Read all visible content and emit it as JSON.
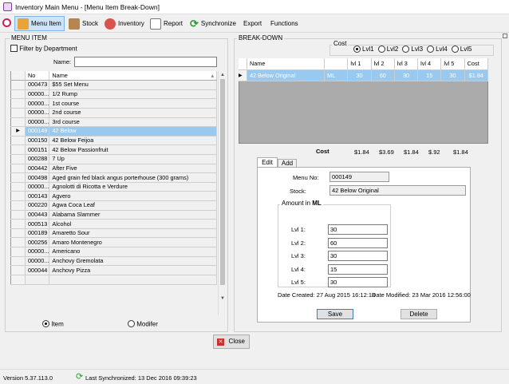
{
  "window": {
    "title": "Inventory Main Menu - [Menu Item Break-Down]"
  },
  "toolbar": [
    {
      "label": "Menu Item",
      "icon": "menu-item-icon",
      "active": true
    },
    {
      "label": "Stock",
      "icon": "stock-icon",
      "active": false
    },
    {
      "label": "Inventory",
      "icon": "inventory-icon",
      "active": false
    },
    {
      "label": "Report",
      "icon": "report-icon",
      "active": false
    },
    {
      "label": "Synchronize",
      "icon": "sync-icon",
      "active": false
    },
    {
      "label": "Export",
      "active": false
    },
    {
      "label": "Functions",
      "active": false
    }
  ],
  "menu_item": {
    "group_title": "MENU ITEM",
    "filter_label": "Filter by Department",
    "filter_checked": false,
    "name_label": "Name:",
    "name_value": "",
    "columns": [
      "No",
      "Name"
    ],
    "rows": [
      {
        "no": "000473",
        "name": "$55 Set Menu"
      },
      {
        "no": "00000...",
        "name": "1/2 Rump"
      },
      {
        "no": "00000...",
        "name": "1st course"
      },
      {
        "no": "00000...",
        "name": "2nd course"
      },
      {
        "no": "00000...",
        "name": "3rd course"
      },
      {
        "no": "000149",
        "name": "42 Below",
        "selected": true
      },
      {
        "no": "000150",
        "name": "42 Below Feijoa"
      },
      {
        "no": "000151",
        "name": "42 Below Passionfruit"
      },
      {
        "no": "000288",
        "name": "7 Up"
      },
      {
        "no": "000442",
        "name": "After Five"
      },
      {
        "no": "000498",
        "name": "Aged grain fed black angus porterhouse (300 grams)"
      },
      {
        "no": "00000...",
        "name": "Agnolotti di Ricotta e Verdure"
      },
      {
        "no": "000143",
        "name": "Agvero"
      },
      {
        "no": "000220",
        "name": "Agwa Coca Leaf"
      },
      {
        "no": "000443",
        "name": "Alabama Slammer"
      },
      {
        "no": "000513",
        "name": "Alcohol"
      },
      {
        "no": "000189",
        "name": "Amaretto Sour"
      },
      {
        "no": "000256",
        "name": "Amaro Montenegro"
      },
      {
        "no": "00000...",
        "name": "Americano"
      },
      {
        "no": "00000...",
        "name": "Anchovy Gremolata"
      },
      {
        "no": "000044",
        "name": "Anchovy Pizza"
      },
      {
        "no": "",
        "name": ""
      }
    ],
    "radio_item": "Item",
    "radio_modifier": "Modifer",
    "selected_radio": "Item"
  },
  "breakdown": {
    "group_title": "BREAK-DOWN",
    "cost_title": "Cost",
    "cost_levels": [
      "Lvl1",
      "Lvl2",
      "Lvl3",
      "Lvl4",
      "Lvl5"
    ],
    "cost_selected": "Lvl1",
    "columns": [
      "Name",
      "",
      "lvl 1",
      "lvl 2",
      "lvl 3",
      "lvl 4",
      "lvl 5",
      "Cost"
    ],
    "row": {
      "name": "42 Below Original",
      "unit": "ML",
      "l1": "30",
      "l2": "60",
      "l3": "30",
      "l4": "15",
      "l5": "30",
      "cost": "$1.84"
    },
    "cost_label": "Cost",
    "totals": [
      "$1.84",
      "$3.69",
      "$1.84",
      "$.92",
      "$1.84"
    ],
    "tabs": [
      "Edit",
      "Add"
    ],
    "active_tab": "Edit",
    "menu_no_label": "Menu No:",
    "menu_no": "000149",
    "stock_label": "Stock:",
    "stock": "42 Below Original",
    "amount_label": "Amount in",
    "amount_unit": "ML",
    "levels": [
      {
        "label": "Lvl 1:",
        "value": "30"
      },
      {
        "label": "Lvl 2:",
        "value": "60"
      },
      {
        "label": "Lvl 3:",
        "value": "30"
      },
      {
        "label": "Lvl 4:",
        "value": "15"
      },
      {
        "label": "Lvl 5:",
        "value": "30"
      }
    ],
    "date_created_label": "Date Created:",
    "date_created": "27 Aug 2015 16:12:18",
    "date_modified_label": "Date Modified:",
    "date_modified": "23 Mar 2016 12:56:00",
    "save_label": "Save",
    "delete_label": "Delete"
  },
  "close_label": "Close",
  "status": {
    "version": "Version 5.37.113.0",
    "sync": "Last Synchronized: 13 Dec 2016 09:39:23"
  }
}
